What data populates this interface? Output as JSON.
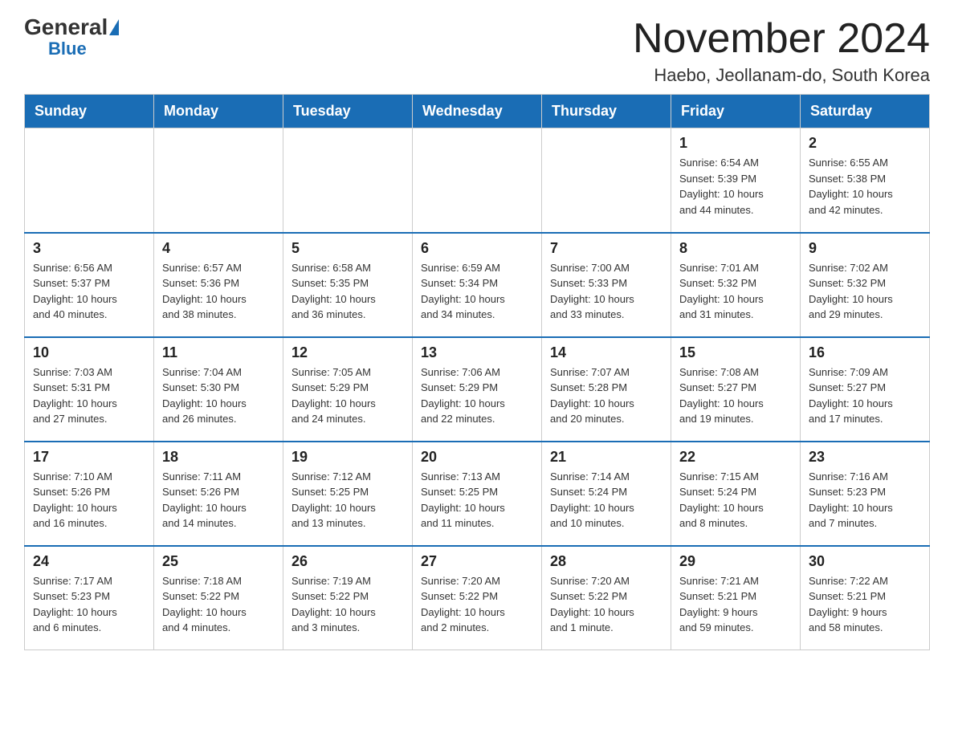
{
  "logo": {
    "general": "General",
    "triangle": "",
    "blue": "Blue"
  },
  "title": "November 2024",
  "subtitle": "Haebo, Jeollanam-do, South Korea",
  "days_of_week": [
    "Sunday",
    "Monday",
    "Tuesday",
    "Wednesday",
    "Thursday",
    "Friday",
    "Saturday"
  ],
  "weeks": [
    [
      {
        "day": "",
        "info": ""
      },
      {
        "day": "",
        "info": ""
      },
      {
        "day": "",
        "info": ""
      },
      {
        "day": "",
        "info": ""
      },
      {
        "day": "",
        "info": ""
      },
      {
        "day": "1",
        "info": "Sunrise: 6:54 AM\nSunset: 5:39 PM\nDaylight: 10 hours\nand 44 minutes."
      },
      {
        "day": "2",
        "info": "Sunrise: 6:55 AM\nSunset: 5:38 PM\nDaylight: 10 hours\nand 42 minutes."
      }
    ],
    [
      {
        "day": "3",
        "info": "Sunrise: 6:56 AM\nSunset: 5:37 PM\nDaylight: 10 hours\nand 40 minutes."
      },
      {
        "day": "4",
        "info": "Sunrise: 6:57 AM\nSunset: 5:36 PM\nDaylight: 10 hours\nand 38 minutes."
      },
      {
        "day": "5",
        "info": "Sunrise: 6:58 AM\nSunset: 5:35 PM\nDaylight: 10 hours\nand 36 minutes."
      },
      {
        "day": "6",
        "info": "Sunrise: 6:59 AM\nSunset: 5:34 PM\nDaylight: 10 hours\nand 34 minutes."
      },
      {
        "day": "7",
        "info": "Sunrise: 7:00 AM\nSunset: 5:33 PM\nDaylight: 10 hours\nand 33 minutes."
      },
      {
        "day": "8",
        "info": "Sunrise: 7:01 AM\nSunset: 5:32 PM\nDaylight: 10 hours\nand 31 minutes."
      },
      {
        "day": "9",
        "info": "Sunrise: 7:02 AM\nSunset: 5:32 PM\nDaylight: 10 hours\nand 29 minutes."
      }
    ],
    [
      {
        "day": "10",
        "info": "Sunrise: 7:03 AM\nSunset: 5:31 PM\nDaylight: 10 hours\nand 27 minutes."
      },
      {
        "day": "11",
        "info": "Sunrise: 7:04 AM\nSunset: 5:30 PM\nDaylight: 10 hours\nand 26 minutes."
      },
      {
        "day": "12",
        "info": "Sunrise: 7:05 AM\nSunset: 5:29 PM\nDaylight: 10 hours\nand 24 minutes."
      },
      {
        "day": "13",
        "info": "Sunrise: 7:06 AM\nSunset: 5:29 PM\nDaylight: 10 hours\nand 22 minutes."
      },
      {
        "day": "14",
        "info": "Sunrise: 7:07 AM\nSunset: 5:28 PM\nDaylight: 10 hours\nand 20 minutes."
      },
      {
        "day": "15",
        "info": "Sunrise: 7:08 AM\nSunset: 5:27 PM\nDaylight: 10 hours\nand 19 minutes."
      },
      {
        "day": "16",
        "info": "Sunrise: 7:09 AM\nSunset: 5:27 PM\nDaylight: 10 hours\nand 17 minutes."
      }
    ],
    [
      {
        "day": "17",
        "info": "Sunrise: 7:10 AM\nSunset: 5:26 PM\nDaylight: 10 hours\nand 16 minutes."
      },
      {
        "day": "18",
        "info": "Sunrise: 7:11 AM\nSunset: 5:26 PM\nDaylight: 10 hours\nand 14 minutes."
      },
      {
        "day": "19",
        "info": "Sunrise: 7:12 AM\nSunset: 5:25 PM\nDaylight: 10 hours\nand 13 minutes."
      },
      {
        "day": "20",
        "info": "Sunrise: 7:13 AM\nSunset: 5:25 PM\nDaylight: 10 hours\nand 11 minutes."
      },
      {
        "day": "21",
        "info": "Sunrise: 7:14 AM\nSunset: 5:24 PM\nDaylight: 10 hours\nand 10 minutes."
      },
      {
        "day": "22",
        "info": "Sunrise: 7:15 AM\nSunset: 5:24 PM\nDaylight: 10 hours\nand 8 minutes."
      },
      {
        "day": "23",
        "info": "Sunrise: 7:16 AM\nSunset: 5:23 PM\nDaylight: 10 hours\nand 7 minutes."
      }
    ],
    [
      {
        "day": "24",
        "info": "Sunrise: 7:17 AM\nSunset: 5:23 PM\nDaylight: 10 hours\nand 6 minutes."
      },
      {
        "day": "25",
        "info": "Sunrise: 7:18 AM\nSunset: 5:22 PM\nDaylight: 10 hours\nand 4 minutes."
      },
      {
        "day": "26",
        "info": "Sunrise: 7:19 AM\nSunset: 5:22 PM\nDaylight: 10 hours\nand 3 minutes."
      },
      {
        "day": "27",
        "info": "Sunrise: 7:20 AM\nSunset: 5:22 PM\nDaylight: 10 hours\nand 2 minutes."
      },
      {
        "day": "28",
        "info": "Sunrise: 7:20 AM\nSunset: 5:22 PM\nDaylight: 10 hours\nand 1 minute."
      },
      {
        "day": "29",
        "info": "Sunrise: 7:21 AM\nSunset: 5:21 PM\nDaylight: 9 hours\nand 59 minutes."
      },
      {
        "day": "30",
        "info": "Sunrise: 7:22 AM\nSunset: 5:21 PM\nDaylight: 9 hours\nand 58 minutes."
      }
    ]
  ]
}
